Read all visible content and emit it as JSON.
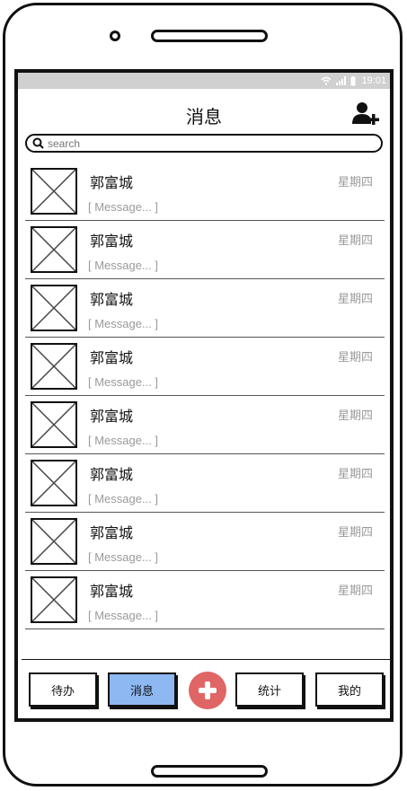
{
  "status": {
    "time": "19:01"
  },
  "header": {
    "title": "消息"
  },
  "search": {
    "placeholder": "search"
  },
  "messages": [
    {
      "name": "郭富城",
      "day": "星期四",
      "preview": "[ Message... ]"
    },
    {
      "name": "郭富城",
      "day": "星期四",
      "preview": "[ Message... ]"
    },
    {
      "name": "郭富城",
      "day": "星期四",
      "preview": "[ Message... ]"
    },
    {
      "name": "郭富城",
      "day": "星期四",
      "preview": "[ Message... ]"
    },
    {
      "name": "郭富城",
      "day": "星期四",
      "preview": "[ Message... ]"
    },
    {
      "name": "郭富城",
      "day": "星期四",
      "preview": "[ Message... ]"
    },
    {
      "name": "郭富城",
      "day": "星期四",
      "preview": "[ Message... ]"
    },
    {
      "name": "郭富城",
      "day": "星期四",
      "preview": "[ Message... ]"
    }
  ],
  "nav": {
    "todo": "待办",
    "messages": "消息",
    "stats": "统计",
    "mine": "我的",
    "active": "messages"
  },
  "colors": {
    "active_tab": "#8eb8f2",
    "fab": "#e06565",
    "status_bar": "#d0d0d0"
  }
}
